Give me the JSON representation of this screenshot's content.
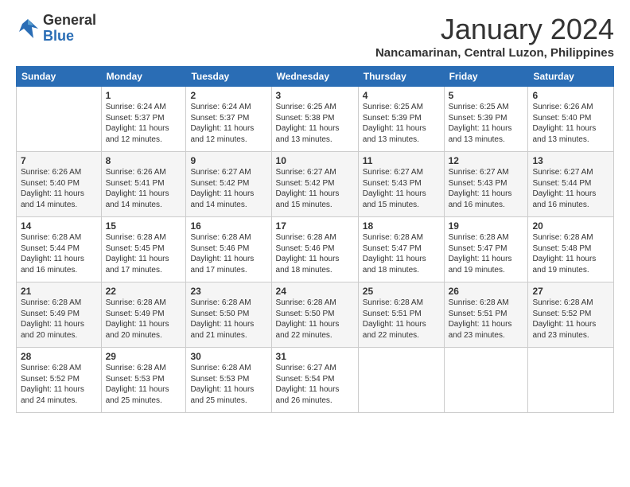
{
  "logo": {
    "general": "General",
    "blue": "Blue"
  },
  "title": "January 2024",
  "location": "Nancamarinan, Central Luzon, Philippines",
  "days_header": [
    "Sunday",
    "Monday",
    "Tuesday",
    "Wednesday",
    "Thursday",
    "Friday",
    "Saturday"
  ],
  "weeks": [
    [
      {
        "num": "",
        "info": ""
      },
      {
        "num": "1",
        "info": "Sunrise: 6:24 AM\nSunset: 5:37 PM\nDaylight: 11 hours\nand 12 minutes."
      },
      {
        "num": "2",
        "info": "Sunrise: 6:24 AM\nSunset: 5:37 PM\nDaylight: 11 hours\nand 12 minutes."
      },
      {
        "num": "3",
        "info": "Sunrise: 6:25 AM\nSunset: 5:38 PM\nDaylight: 11 hours\nand 13 minutes."
      },
      {
        "num": "4",
        "info": "Sunrise: 6:25 AM\nSunset: 5:39 PM\nDaylight: 11 hours\nand 13 minutes."
      },
      {
        "num": "5",
        "info": "Sunrise: 6:25 AM\nSunset: 5:39 PM\nDaylight: 11 hours\nand 13 minutes."
      },
      {
        "num": "6",
        "info": "Sunrise: 6:26 AM\nSunset: 5:40 PM\nDaylight: 11 hours\nand 13 minutes."
      }
    ],
    [
      {
        "num": "7",
        "info": "Sunrise: 6:26 AM\nSunset: 5:40 PM\nDaylight: 11 hours\nand 14 minutes."
      },
      {
        "num": "8",
        "info": "Sunrise: 6:26 AM\nSunset: 5:41 PM\nDaylight: 11 hours\nand 14 minutes."
      },
      {
        "num": "9",
        "info": "Sunrise: 6:27 AM\nSunset: 5:42 PM\nDaylight: 11 hours\nand 14 minutes."
      },
      {
        "num": "10",
        "info": "Sunrise: 6:27 AM\nSunset: 5:42 PM\nDaylight: 11 hours\nand 15 minutes."
      },
      {
        "num": "11",
        "info": "Sunrise: 6:27 AM\nSunset: 5:43 PM\nDaylight: 11 hours\nand 15 minutes."
      },
      {
        "num": "12",
        "info": "Sunrise: 6:27 AM\nSunset: 5:43 PM\nDaylight: 11 hours\nand 16 minutes."
      },
      {
        "num": "13",
        "info": "Sunrise: 6:27 AM\nSunset: 5:44 PM\nDaylight: 11 hours\nand 16 minutes."
      }
    ],
    [
      {
        "num": "14",
        "info": "Sunrise: 6:28 AM\nSunset: 5:44 PM\nDaylight: 11 hours\nand 16 minutes."
      },
      {
        "num": "15",
        "info": "Sunrise: 6:28 AM\nSunset: 5:45 PM\nDaylight: 11 hours\nand 17 minutes."
      },
      {
        "num": "16",
        "info": "Sunrise: 6:28 AM\nSunset: 5:46 PM\nDaylight: 11 hours\nand 17 minutes."
      },
      {
        "num": "17",
        "info": "Sunrise: 6:28 AM\nSunset: 5:46 PM\nDaylight: 11 hours\nand 18 minutes."
      },
      {
        "num": "18",
        "info": "Sunrise: 6:28 AM\nSunset: 5:47 PM\nDaylight: 11 hours\nand 18 minutes."
      },
      {
        "num": "19",
        "info": "Sunrise: 6:28 AM\nSunset: 5:47 PM\nDaylight: 11 hours\nand 19 minutes."
      },
      {
        "num": "20",
        "info": "Sunrise: 6:28 AM\nSunset: 5:48 PM\nDaylight: 11 hours\nand 19 minutes."
      }
    ],
    [
      {
        "num": "21",
        "info": "Sunrise: 6:28 AM\nSunset: 5:49 PM\nDaylight: 11 hours\nand 20 minutes."
      },
      {
        "num": "22",
        "info": "Sunrise: 6:28 AM\nSunset: 5:49 PM\nDaylight: 11 hours\nand 20 minutes."
      },
      {
        "num": "23",
        "info": "Sunrise: 6:28 AM\nSunset: 5:50 PM\nDaylight: 11 hours\nand 21 minutes."
      },
      {
        "num": "24",
        "info": "Sunrise: 6:28 AM\nSunset: 5:50 PM\nDaylight: 11 hours\nand 22 minutes."
      },
      {
        "num": "25",
        "info": "Sunrise: 6:28 AM\nSunset: 5:51 PM\nDaylight: 11 hours\nand 22 minutes."
      },
      {
        "num": "26",
        "info": "Sunrise: 6:28 AM\nSunset: 5:51 PM\nDaylight: 11 hours\nand 23 minutes."
      },
      {
        "num": "27",
        "info": "Sunrise: 6:28 AM\nSunset: 5:52 PM\nDaylight: 11 hours\nand 23 minutes."
      }
    ],
    [
      {
        "num": "28",
        "info": "Sunrise: 6:28 AM\nSunset: 5:52 PM\nDaylight: 11 hours\nand 24 minutes."
      },
      {
        "num": "29",
        "info": "Sunrise: 6:28 AM\nSunset: 5:53 PM\nDaylight: 11 hours\nand 25 minutes."
      },
      {
        "num": "30",
        "info": "Sunrise: 6:28 AM\nSunset: 5:53 PM\nDaylight: 11 hours\nand 25 minutes."
      },
      {
        "num": "31",
        "info": "Sunrise: 6:27 AM\nSunset: 5:54 PM\nDaylight: 11 hours\nand 26 minutes."
      },
      {
        "num": "",
        "info": ""
      },
      {
        "num": "",
        "info": ""
      },
      {
        "num": "",
        "info": ""
      }
    ]
  ]
}
